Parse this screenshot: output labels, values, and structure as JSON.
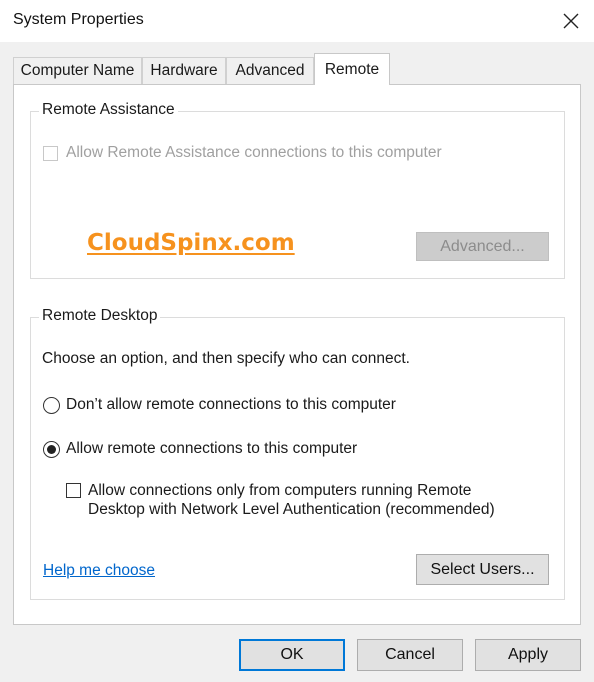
{
  "window": {
    "title": "System Properties"
  },
  "tabs": [
    {
      "label": "Computer Name"
    },
    {
      "label": "Hardware"
    },
    {
      "label": "Advanced"
    },
    {
      "label": "Remote",
      "active": true
    }
  ],
  "remote_assistance": {
    "group_label": "Remote Assistance",
    "allow_checkbox_label": "Allow Remote Assistance connections to this computer",
    "allow_checked": false,
    "advanced_button": "Advanced..."
  },
  "watermark": "CloudSpinx.com",
  "remote_desktop": {
    "group_label": "Remote Desktop",
    "instruction": "Choose an option, and then specify who can connect.",
    "option_dont_allow": "Don’t allow remote connections to this computer",
    "option_allow": "Allow remote connections to this computer",
    "selected_option": "allow",
    "nla_line1": "Allow connections only from computers running Remote",
    "nla_line2": "Desktop with Network Level Authentication (recommended)",
    "nla_checked": false,
    "help_link": "Help me choose",
    "select_users_button": "Select Users..."
  },
  "footer": {
    "ok": "OK",
    "cancel": "Cancel",
    "apply": "Apply"
  },
  "colors": {
    "accent": "#0078d7",
    "link": "#0066cc",
    "watermark": "#f6921e"
  },
  "icons": {
    "close": "close-icon"
  }
}
